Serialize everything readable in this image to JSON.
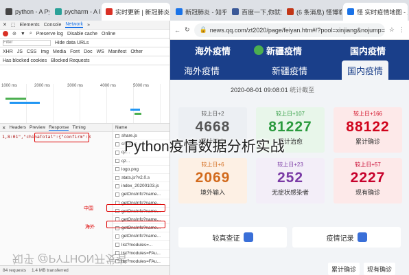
{
  "tabs": [
    {
      "title": "python - A Pytho",
      "color": "#444"
    },
    {
      "title": "pycharm - A Pyt",
      "color": "#2aa198"
    },
    {
      "title": "实时更新 | 新冠肺炎疫情",
      "color": "#d93025"
    },
    {
      "title": "新冠肺炎 - 知乎",
      "color": "#1a73e8"
    },
    {
      "title": "百度一下,你就知道",
      "color": "#3b5998"
    },
    {
      "title": "(6 条消息) 怪博客的 Pyth",
      "color": "#c23616"
    },
    {
      "title": "怪 实时疫情地图 - 腾讯新闻",
      "color": "#1a73e8"
    }
  ],
  "address": {
    "url": "news.qq.com/zt2020/page/feiyan.htm#/?pool=xinjiang&nojump=1"
  },
  "devtools": {
    "main_tabs": [
      "Elements",
      "Console",
      "Network"
    ],
    "toolbar": [
      "Preserve log",
      "Disable cache",
      "Online"
    ],
    "filter": {
      "placeholder": "Filter",
      "hide": "Hide data URLs"
    },
    "types": [
      "XHR",
      "JS",
      "CSS",
      "Img",
      "Media",
      "Font",
      "Doc",
      "WS",
      "Manifest",
      "Other"
    ],
    "blocked": [
      "Has blocked cookies",
      "Blocked Requests"
    ],
    "timeline": [
      "1000 ms",
      "2000 ms",
      "3000 ms",
      "4000 ms",
      "5000 ms"
    ],
    "detail_tabs": [
      "Headers",
      "Preview",
      "Response",
      "Timing"
    ],
    "response_text": "1,8:01\",\"chinaTotal\":{\"confirm\":8",
    "annotations": [
      "中国",
      "海外"
    ],
    "requests": [
      "share.js",
      "share.js",
      "qz...",
      "qz...",
      "logo.png",
      "stats.js?v2.0.s",
      "index_20200103.js",
      "getOnsInfo?name...",
      "getOnsInfo?name...",
      "getOnsInfo?name...",
      "getOnsInfo?name...",
      "getOnsInfo?name...",
      "getOnsInfo?name...",
      "list?modules=...",
      "list?modules=FAu...",
      "list?modules=FAu...",
      "list?modules=no..."
    ],
    "summary": {
      "requests": "84 requests",
      "transferred": "1.4 MB transferred"
    },
    "drawer_tabs": [
      "Console",
      "What's New"
    ]
  },
  "site": {
    "banner_tabs": [
      "国内疫情",
      "新疆疫情",
      "海外疫情"
    ],
    "sub_tabs": [
      "海外疫情",
      "新疆疫情",
      "国内疫情"
    ],
    "time_label": "统计截至",
    "time": "2020-08-01 09:08:01",
    "cards": [
      {
        "label": "较上日+166",
        "value": "88122",
        "name": "累计确诊",
        "bg": "#fde9e9",
        "fg": "#d0021b"
      },
      {
        "label": "较上日+107",
        "value": "81227",
        "name": "累计治愈",
        "bg": "#e8f6ea",
        "fg": "#2b9a3e"
      },
      {
        "label": "较上日+2",
        "value": "4668",
        "name": "累计死亡",
        "bg": "#eceff3",
        "fg": "#555"
      },
      {
        "label": "较上日+57",
        "value": "2227",
        "name": "现有确诊",
        "bg": "#fde9e9",
        "fg": "#c7002b"
      },
      {
        "label": "较上日+23",
        "value": "252",
        "name": "无症状感染者",
        "bg": "#f3eef8",
        "fg": "#7a3aa5"
      },
      {
        "label": "较上日+6",
        "value": "2069",
        "name": "境外输入",
        "bg": "#fdf0e4",
        "fg": "#d26a1c"
      }
    ],
    "buttons": [
      "疫情记录",
      "较真查证"
    ],
    "footer_tabs": [
      "累计确诊",
      "现有确诊"
    ]
  },
  "overlay_title": "Python疫情数据分析实战",
  "watermark": "知乎 @PYTHON开发者"
}
